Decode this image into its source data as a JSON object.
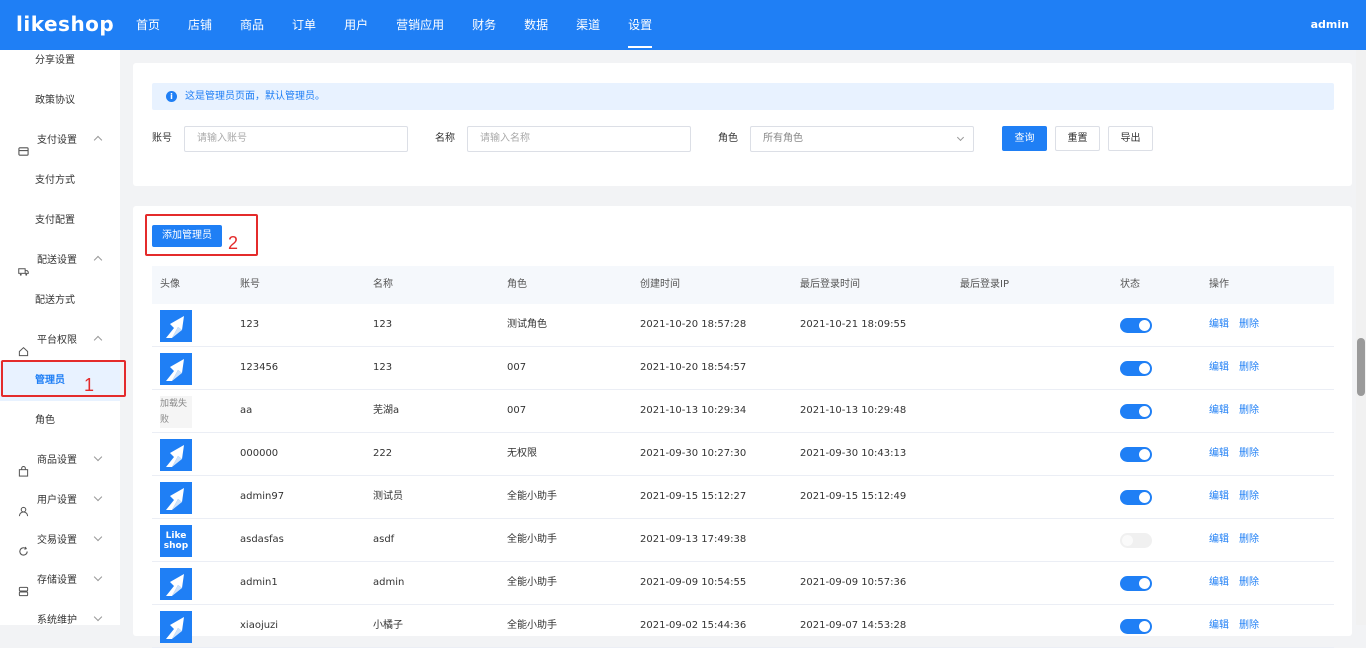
{
  "header": {
    "logo": "likeshop",
    "nav": [
      "首页",
      "店铺",
      "商品",
      "订单",
      "用户",
      "营销应用",
      "财务",
      "数据",
      "渠道",
      "设置"
    ],
    "active_nav": "设置",
    "admin": "admin"
  },
  "sidebar": {
    "items": [
      {
        "label": "分享设置",
        "type": "sub"
      },
      {
        "label": "政策协议",
        "type": "sub"
      },
      {
        "label": "支付设置",
        "type": "group",
        "icon": "payment-icon",
        "expanded": true
      },
      {
        "label": "支付方式",
        "type": "sub"
      },
      {
        "label": "支付配置",
        "type": "sub"
      },
      {
        "label": "配送设置",
        "type": "group",
        "icon": "truck-icon",
        "expanded": true
      },
      {
        "label": "配送方式",
        "type": "sub"
      },
      {
        "label": "平台权限",
        "type": "group",
        "icon": "home-icon",
        "expanded": true
      },
      {
        "label": "管理员",
        "type": "sub",
        "active": true
      },
      {
        "label": "角色",
        "type": "sub"
      },
      {
        "label": "商品设置",
        "type": "group",
        "icon": "bag-icon",
        "expanded": false
      },
      {
        "label": "用户设置",
        "type": "group",
        "icon": "user-icon",
        "expanded": false
      },
      {
        "label": "交易设置",
        "type": "group",
        "icon": "refresh-icon",
        "expanded": false
      },
      {
        "label": "存储设置",
        "type": "group",
        "icon": "database-icon",
        "expanded": false
      },
      {
        "label": "系统维护",
        "type": "group",
        "icon": "list-icon",
        "expanded": false
      }
    ]
  },
  "annotations": {
    "one": "1",
    "two": "2"
  },
  "filter": {
    "notice": "这是管理员页面，默认管理员。",
    "account_label": "账号",
    "account_placeholder": "请输入账号",
    "name_label": "名称",
    "name_placeholder": "请输入名称",
    "role_label": "角色",
    "role_value": "所有角色",
    "query_btn": "查询",
    "reset_btn": "重置",
    "export_btn": "导出"
  },
  "table": {
    "add_btn": "添加管理员",
    "columns": [
      "头像",
      "账号",
      "名称",
      "角色",
      "创建时间",
      "最后登录时间",
      "最后登录IP",
      "状态",
      "操作"
    ],
    "edit_label": "编辑",
    "delete_label": "删除",
    "rows": [
      {
        "avatar": "arrow",
        "avatar_text": "",
        "account": "123",
        "name": "123",
        "role": "测试角色",
        "created": "2021-10-20 18:57:28",
        "last_login": "2021-10-21 18:09:55",
        "status": true
      },
      {
        "avatar": "arrow",
        "avatar_text": "",
        "account": "123456",
        "name": "123",
        "role": "007",
        "created": "2021-10-20 18:54:57",
        "last_login": "",
        "status": true
      },
      {
        "avatar": "fail",
        "avatar_text": "加载失败",
        "account": "aa",
        "name": "芜湖a",
        "role": "007",
        "created": "2021-10-13 10:29:34",
        "last_login": "2021-10-13 10:29:48",
        "status": true
      },
      {
        "avatar": "arrow",
        "avatar_text": "",
        "account": "000000",
        "name": "222",
        "role": "无权限",
        "created": "2021-09-30 10:27:30",
        "last_login": "2021-09-30 10:43:13",
        "status": true
      },
      {
        "avatar": "arrow",
        "avatar_text": "",
        "account": "admin97",
        "name": "测试员",
        "role": "全能小助手",
        "created": "2021-09-15 15:12:27",
        "last_login": "2021-09-15 15:12:49",
        "status": true
      },
      {
        "avatar": "logo",
        "avatar_text": "Like shop",
        "account": "asdasfas",
        "name": "asdf",
        "role": "全能小助手",
        "created": "2021-09-13 17:49:38",
        "last_login": "",
        "status": false
      },
      {
        "avatar": "arrow",
        "avatar_text": "",
        "account": "admin1",
        "name": "admin",
        "role": "全能小助手",
        "created": "2021-09-09 10:54:55",
        "last_login": "2021-09-09 10:57:36",
        "status": true
      },
      {
        "avatar": "arrow",
        "avatar_text": "",
        "account": "xiaojuzi",
        "name": "小橘子",
        "role": "全能小助手",
        "created": "2021-09-02 15:44:36",
        "last_login": "2021-09-07 14:53:28",
        "status": true
      }
    ]
  },
  "colors": {
    "primary": "#1f7ff5",
    "highlight": "#e42b2b"
  }
}
